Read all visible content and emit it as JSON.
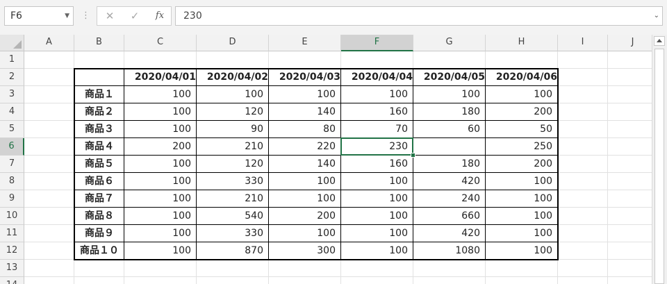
{
  "formula_bar": {
    "name_box": "F6",
    "dots": "⋮",
    "cancel_glyph": "✕",
    "enter_glyph": "✓",
    "fx_label": "fx",
    "formula": "230",
    "expand_glyph": "⌄"
  },
  "columns": [
    "A",
    "B",
    "C",
    "D",
    "E",
    "F",
    "G",
    "H",
    "I",
    "J"
  ],
  "rows": [
    "1",
    "2",
    "3",
    "4",
    "5",
    "6",
    "7",
    "8",
    "9",
    "10",
    "11",
    "12",
    "13",
    "14"
  ],
  "selected": {
    "column": "F",
    "row": "6"
  },
  "table": {
    "dates": [
      "2020/04/01",
      "2020/04/02",
      "2020/04/03",
      "2020/04/04",
      "2020/04/05",
      "2020/04/06"
    ],
    "products": [
      {
        "name": "商品１",
        "values": [
          "100",
          "100",
          "100",
          "100",
          "100",
          "100"
        ]
      },
      {
        "name": "商品２",
        "values": [
          "100",
          "120",
          "140",
          "160",
          "180",
          "200"
        ]
      },
      {
        "name": "商品３",
        "values": [
          "100",
          "90",
          "80",
          "70",
          "60",
          "50"
        ]
      },
      {
        "name": "商品４",
        "values": [
          "200",
          "210",
          "220",
          "230",
          "",
          "250"
        ]
      },
      {
        "name": "商品５",
        "values": [
          "100",
          "120",
          "140",
          "160",
          "180",
          "200"
        ]
      },
      {
        "name": "商品６",
        "values": [
          "100",
          "330",
          "100",
          "100",
          "420",
          "100"
        ]
      },
      {
        "name": "商品７",
        "values": [
          "100",
          "210",
          "100",
          "100",
          "240",
          "100"
        ]
      },
      {
        "name": "商品８",
        "values": [
          "100",
          "540",
          "200",
          "100",
          "660",
          "100"
        ]
      },
      {
        "name": "商品９",
        "values": [
          "100",
          "330",
          "100",
          "100",
          "420",
          "100"
        ]
      },
      {
        "name": "商品１０",
        "values": [
          "100",
          "870",
          "300",
          "100",
          "1080",
          "100"
        ]
      }
    ]
  },
  "colors": {
    "accent": "#217346",
    "header_bg": "#f2f2f2",
    "gridline": "#e1e1e1"
  }
}
